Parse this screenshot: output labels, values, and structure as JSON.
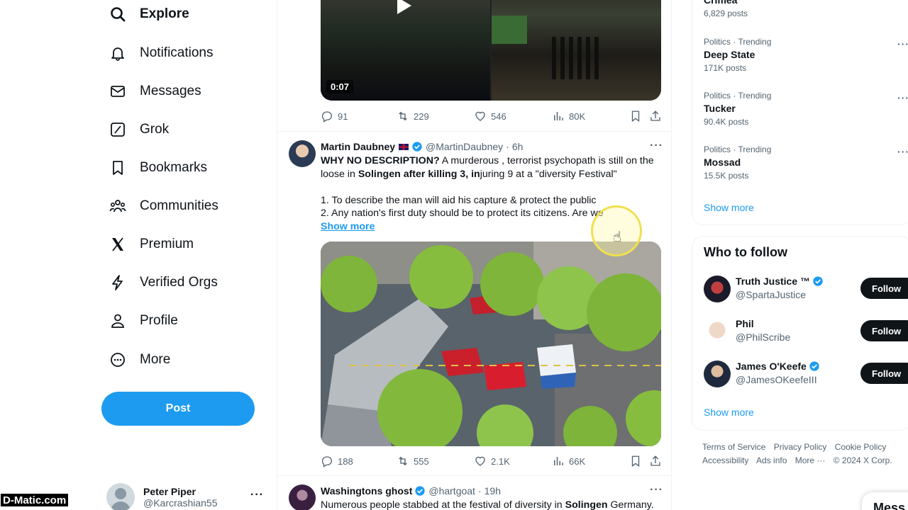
{
  "nav": {
    "items": [
      {
        "label": "Explore",
        "icon": "search-icon",
        "active": true
      },
      {
        "label": "Notifications",
        "icon": "bell-icon"
      },
      {
        "label": "Messages",
        "icon": "envelope-icon"
      },
      {
        "label": "Grok",
        "icon": "grok-icon"
      },
      {
        "label": "Bookmarks",
        "icon": "bookmark-icon"
      },
      {
        "label": "Communities",
        "icon": "people-icon"
      },
      {
        "label": "Premium",
        "icon": "x-logo-icon"
      },
      {
        "label": "Verified Orgs",
        "icon": "lightning-icon"
      },
      {
        "label": "Profile",
        "icon": "person-icon"
      },
      {
        "label": "More",
        "icon": "more-circle-icon"
      }
    ],
    "post_label": "Post",
    "account": {
      "name": "Peter Piper",
      "handle": "@Karcrashian55"
    }
  },
  "watermark": "D-Matic.com",
  "feed": {
    "prev_tweet": {
      "video_time": "0:07",
      "replies": "91",
      "reposts": "229",
      "likes": "546",
      "views": "80K"
    },
    "tweet1": {
      "name": "Martin Daubney",
      "handle": "@MartinDaubney",
      "time": "6h",
      "text_line1_bold": "WHY NO DESCRIPTION?",
      "text_line1_rest": " A murderous , terrorist psychopath is still on the",
      "text_line2_pre": "loose in ",
      "text_line2_bold": "Solingen after killing 3, in",
      "text_line2_rest": "juring 9 at a \"diversity Festival\"",
      "text_line3": "1. To describe the man will aid his capture & protect the public",
      "text_line4": "2. Any nation's first duty should be to protect its citizens. Are we",
      "show_more": "Show more",
      "replies": "188",
      "reposts": "555",
      "likes": "2.1K",
      "views": "66K"
    },
    "tweet2": {
      "name": "Washingtons ghost",
      "handle": "@hartgoat",
      "time": "19h",
      "text_pre": "Numerous people stabbed at the festival of diversity in ",
      "text_bold": "Solingen",
      "text_post": " Germany."
    }
  },
  "trends": {
    "partial_name": "Crimea",
    "partial_count": "6,829 posts",
    "items": [
      {
        "category": "Politics · Trending",
        "name": "Deep State",
        "count": "171K posts"
      },
      {
        "category": "Politics · Trending",
        "name": "Tucker",
        "count": "90.4K posts"
      },
      {
        "category": "Politics · Trending",
        "name": "Mossad",
        "count": "15.5K posts"
      }
    ],
    "show_more": "Show more"
  },
  "who_to_follow": {
    "title": "Who to follow",
    "items": [
      {
        "name": "Truth Justice ™",
        "handle": "@SpartaJustice",
        "verified": true
      },
      {
        "name": "Phil",
        "handle": "@PhilScribe",
        "verified": false
      },
      {
        "name": "James O'Keefe",
        "handle": "@JamesOKeefeIII",
        "verified": true
      }
    ],
    "follow_label": "Follow",
    "show_more": "Show more"
  },
  "footer": {
    "links": [
      "Terms of Service",
      "Privacy Policy",
      "Cookie Policy",
      "Accessibility",
      "Ads info",
      "More ···",
      "© 2024 X Corp."
    ]
  },
  "messages_pill": "Mess",
  "colors": {
    "accent": "#1d9bf0",
    "text": "#0f1419",
    "muted": "#536471",
    "follow_bg": "#0f1419"
  }
}
